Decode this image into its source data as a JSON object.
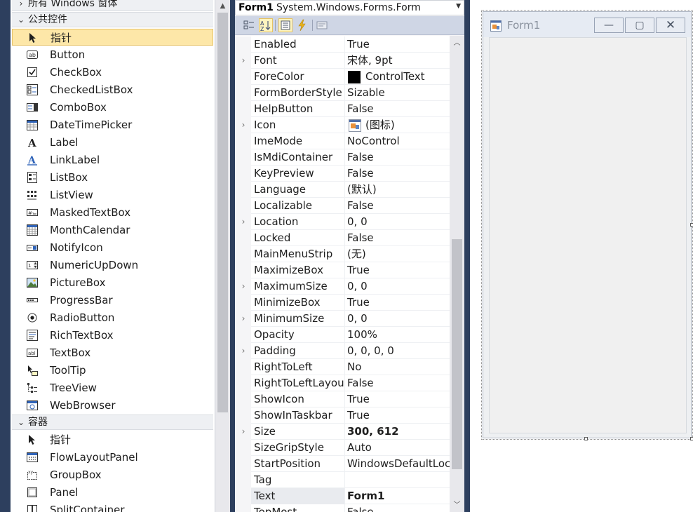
{
  "toolbox": {
    "categories": {
      "all_windows": "所有 Windows 窗体",
      "common": "公共控件",
      "containers": "容器"
    },
    "common_items": [
      {
        "label": "指针",
        "icon": "pointer-icon",
        "selected": true
      },
      {
        "label": "Button",
        "icon": "button-icon"
      },
      {
        "label": "CheckBox",
        "icon": "checkbox-icon"
      },
      {
        "label": "CheckedListBox",
        "icon": "checkedlistbox-icon"
      },
      {
        "label": "ComboBox",
        "icon": "combobox-icon"
      },
      {
        "label": "DateTimePicker",
        "icon": "datetimepicker-icon"
      },
      {
        "label": "Label",
        "icon": "label-icon"
      },
      {
        "label": "LinkLabel",
        "icon": "linklabel-icon"
      },
      {
        "label": "ListBox",
        "icon": "listbox-icon"
      },
      {
        "label": "ListView",
        "icon": "listview-icon"
      },
      {
        "label": "MaskedTextBox",
        "icon": "maskedtextbox-icon"
      },
      {
        "label": "MonthCalendar",
        "icon": "monthcalendar-icon"
      },
      {
        "label": "NotifyIcon",
        "icon": "notifyicon-icon"
      },
      {
        "label": "NumericUpDown",
        "icon": "numericupdown-icon"
      },
      {
        "label": "PictureBox",
        "icon": "picturebox-icon"
      },
      {
        "label": "ProgressBar",
        "icon": "progressbar-icon"
      },
      {
        "label": "RadioButton",
        "icon": "radiobutton-icon"
      },
      {
        "label": "RichTextBox",
        "icon": "richtextbox-icon"
      },
      {
        "label": "TextBox",
        "icon": "textbox-icon"
      },
      {
        "label": "ToolTip",
        "icon": "tooltip-icon"
      },
      {
        "label": "TreeView",
        "icon": "treeview-icon"
      },
      {
        "label": "WebBrowser",
        "icon": "webbrowser-icon"
      }
    ],
    "container_items": [
      {
        "label": "指针",
        "icon": "pointer-icon"
      },
      {
        "label": "FlowLayoutPanel",
        "icon": "flowlayoutpanel-icon"
      },
      {
        "label": "GroupBox",
        "icon": "groupbox-icon"
      },
      {
        "label": "Panel",
        "icon": "panel-icon"
      },
      {
        "label": "SplitContainer",
        "icon": "splitcontainer-icon"
      }
    ]
  },
  "properties": {
    "object_name": "Form1",
    "object_type": "System.Windows.Forms.Form",
    "rows": [
      {
        "name": "Enabled",
        "value": "True"
      },
      {
        "name": "Font",
        "value": "宋体, 9pt",
        "expandable": true
      },
      {
        "name": "ForeColor",
        "value": "ControlText",
        "swatch": "#000000"
      },
      {
        "name": "FormBorderStyle",
        "value": "Sizable"
      },
      {
        "name": "HelpButton",
        "value": "False"
      },
      {
        "name": "Icon",
        "value": "(图标)",
        "expandable": true,
        "icon": "form-icon"
      },
      {
        "name": "ImeMode",
        "value": "NoControl"
      },
      {
        "name": "IsMdiContainer",
        "value": "False"
      },
      {
        "name": "KeyPreview",
        "value": "False"
      },
      {
        "name": "Language",
        "value": "(默认)"
      },
      {
        "name": "Localizable",
        "value": "False"
      },
      {
        "name": "Location",
        "value": "0, 0",
        "expandable": true
      },
      {
        "name": "Locked",
        "value": "False"
      },
      {
        "name": "MainMenuStrip",
        "value": "(无)"
      },
      {
        "name": "MaximizeBox",
        "value": "True"
      },
      {
        "name": "MaximumSize",
        "value": "0, 0",
        "expandable": true
      },
      {
        "name": "MinimizeBox",
        "value": "True"
      },
      {
        "name": "MinimumSize",
        "value": "0, 0",
        "expandable": true
      },
      {
        "name": "Opacity",
        "value": "100%"
      },
      {
        "name": "Padding",
        "value": "0, 0, 0, 0",
        "expandable": true
      },
      {
        "name": "RightToLeft",
        "value": "No"
      },
      {
        "name": "RightToLeftLayout",
        "value": "False"
      },
      {
        "name": "ShowIcon",
        "value": "True"
      },
      {
        "name": "ShowInTaskbar",
        "value": "True"
      },
      {
        "name": "Size",
        "value": "300, 612",
        "expandable": true,
        "bold": true
      },
      {
        "name": "SizeGripStyle",
        "value": "Auto"
      },
      {
        "name": "StartPosition",
        "value": "WindowsDefaultLocation"
      },
      {
        "name": "Tag",
        "value": ""
      },
      {
        "name": "Text",
        "value": "Form1",
        "bold": true,
        "selected": true
      },
      {
        "name": "TopMost",
        "value": "False"
      }
    ]
  },
  "designer": {
    "form_title": "Form1"
  },
  "colors": {
    "selection_bg": "#fde7a8",
    "panel_chrome": "#2d3f5e",
    "toolbar_bg": "#cfd6e5"
  }
}
